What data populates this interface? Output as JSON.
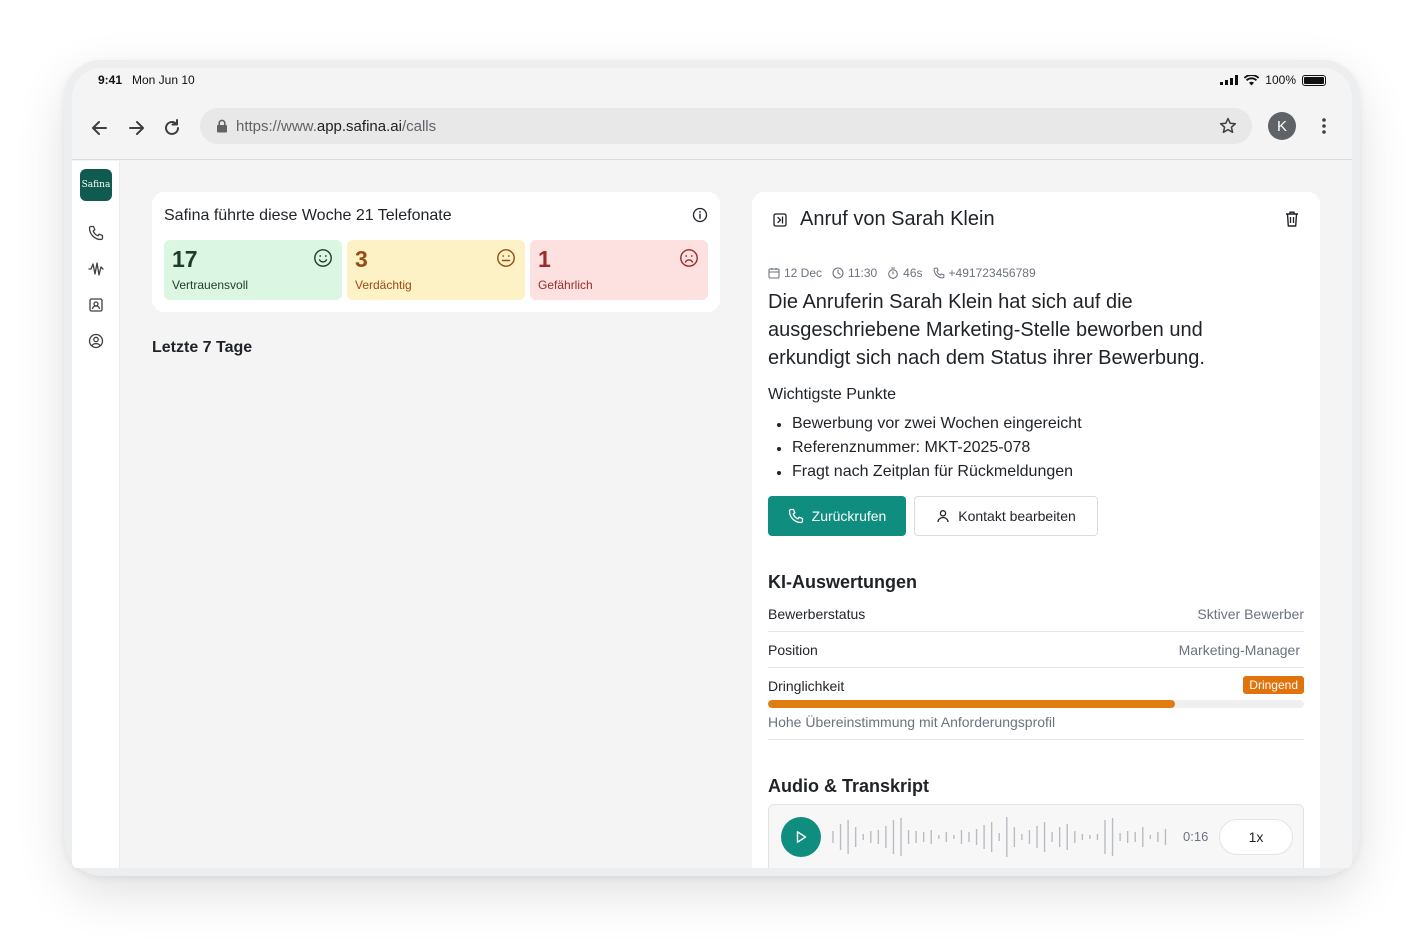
{
  "status_bar": {
    "time": "9:41",
    "date": "Mon Jun 10",
    "battery": "100%"
  },
  "browser": {
    "url_prefix": "https://www.",
    "url_domain": "app.safina.ai",
    "url_path": "/calls",
    "avatar_initial": "K"
  },
  "sidebar": {
    "logo_text": "Safina"
  },
  "summary": {
    "title": "Safina führte diese Woche 21 Telefonate",
    "stats": [
      {
        "count": "17",
        "label": "Vertrauensvoll"
      },
      {
        "count": "3",
        "label": "Verdächtig"
      },
      {
        "count": "1",
        "label": "Gefährlich"
      }
    ]
  },
  "recent": {
    "title": "Letzte 7 Tage"
  },
  "detail": {
    "title": "Anruf von Sarah Klein",
    "meta": {
      "date": "12 Dec",
      "time": "11:30",
      "duration": "46s",
      "phone": "+491723456789"
    },
    "summary_text": "Die Anruferin Sarah Klein hat sich auf die ausgeschriebene Marketing-Stelle beworben und erkundigt sich nach dem Status ihrer Bewerbung.",
    "key_points_title": "Wichtigste Punkte",
    "key_points": [
      "Bewerbung vor zwei Wochen eingereicht",
      "Referenznummer: MKT-2025-078",
      "Fragt nach Zeitplan für Rückmeldungen"
    ],
    "callback_label": "Zurückrufen",
    "edit_contact_label": "Kontakt bearbeiten"
  },
  "ki": {
    "title": "KI-Auswertungen",
    "rows": [
      {
        "key": "Bewerberstatus",
        "value": "Sktiver Bewerber"
      },
      {
        "key": "Position",
        "value": "Marketing-Manager"
      }
    ],
    "urgency": {
      "key": "Dringlichkeit",
      "badge": "Dringend",
      "level": 0.76
    },
    "match_text": "Hohe Übereinstimmung mit Anforderungsprofil"
  },
  "audio": {
    "title": "Audio & Transkript",
    "duration": "0:16",
    "speed": "1x"
  },
  "colors": {
    "accent": "#0f8e80",
    "brand": "#0f5b4f",
    "urgent": "#e0730b"
  }
}
